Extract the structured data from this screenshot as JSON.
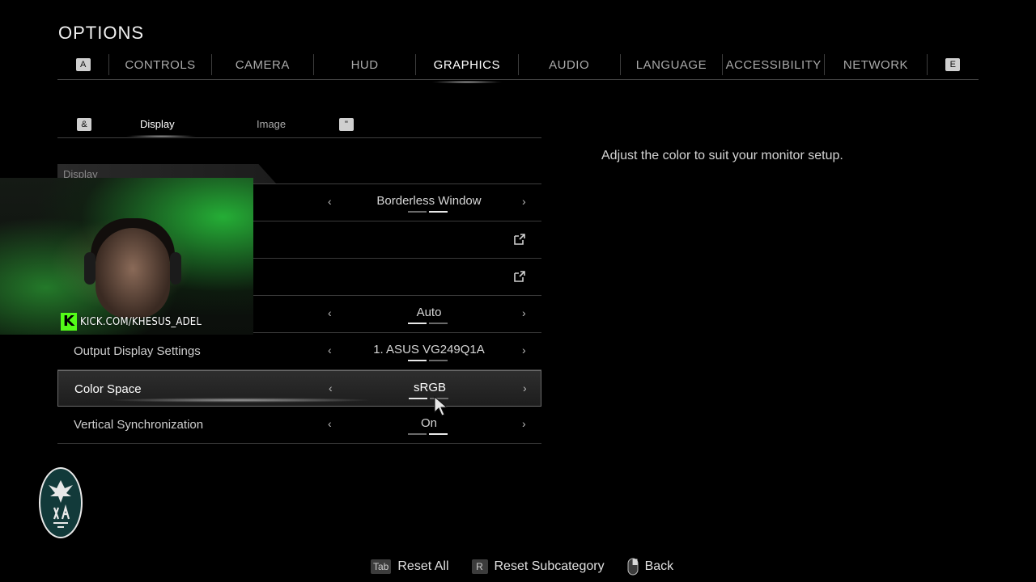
{
  "title": "OPTIONS",
  "tabs": {
    "left_key": "A",
    "right_key": "E",
    "items": [
      {
        "label": "CONTROLS"
      },
      {
        "label": "CAMERA"
      },
      {
        "label": "HUD"
      },
      {
        "label": "GRAPHICS",
        "active": true
      },
      {
        "label": "AUDIO"
      },
      {
        "label": "LANGUAGE"
      },
      {
        "label": "ACCESSIBILITY"
      },
      {
        "label": "NETWORK"
      }
    ]
  },
  "subtabs": {
    "left_key": "&",
    "right_key": "\"",
    "items": [
      {
        "label": "Display",
        "active": true
      },
      {
        "label": "Image"
      }
    ]
  },
  "section_header": "Display",
  "settings": [
    {
      "label": "",
      "value": "Borderless Window",
      "pips": 2,
      "active_pip": 1,
      "type": "selector"
    },
    {
      "label": "",
      "type": "external",
      "icon": "external-link-icon"
    },
    {
      "label": "",
      "type": "external",
      "icon": "external-link-icon"
    },
    {
      "label": "",
      "value": "Auto",
      "pips": 2,
      "active_pip": 0,
      "type": "selector"
    },
    {
      "label": "Output Display Settings",
      "value": "1. ASUS VG249Q1A",
      "pips": 2,
      "active_pip": 0,
      "type": "selector"
    },
    {
      "label": "Color Space",
      "value": "sRGB",
      "pips": 2,
      "active_pip": 0,
      "type": "selector",
      "selected": true
    },
    {
      "label": "Vertical Synchronization",
      "value": "On",
      "pips": 2,
      "active_pip": 1,
      "type": "selector"
    }
  ],
  "description": "Adjust the color to suit your monitor setup.",
  "webcam": {
    "kick_letter": "K",
    "channel": "KICK.COM/KHESUS_ADEL"
  },
  "footer": {
    "reset_all_key": "Tab",
    "reset_all": "Reset All",
    "reset_sub_key": "R",
    "reset_sub": "Reset Subcategory",
    "back_icon": "mouse-icon",
    "back": "Back"
  },
  "colors": {
    "background": "#000000",
    "kick_green": "#53fc18",
    "badge_teal": "#123a3a"
  }
}
